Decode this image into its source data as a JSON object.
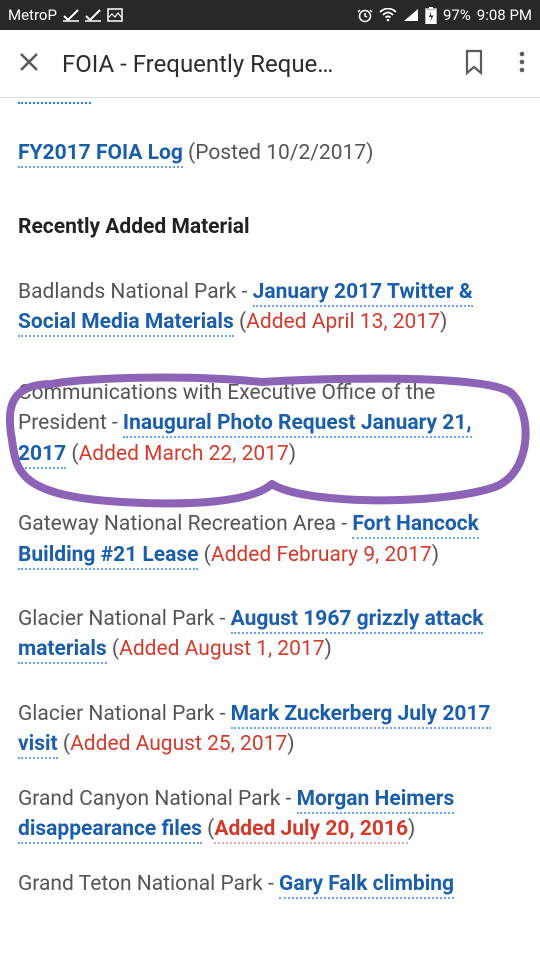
{
  "status": {
    "carrier": "MetroP",
    "battery": "97%",
    "time": "9:08 PM"
  },
  "header": {
    "title": "FOIA - Frequently Reque…"
  },
  "top_link": {
    "label": "FY2017 FOIA Log",
    "posted": " (Posted 10/2/2017)"
  },
  "section_title": "Recently Added Material",
  "items": [
    {
      "prefix": "Badlands National Park - ",
      "link": "January 2017 Twitter & Social Media Materials",
      "added": "Added April 13, 2017"
    },
    {
      "prefix": "Communications with Executive Office of the President - ",
      "link": "Inaugural Photo Request January 21, 2017",
      "added": "Added March 22, 2017"
    },
    {
      "prefix": "Gateway National Recreation Area - ",
      "link": "Fort Hancock Building #21 Lease",
      "added": "Added February 9, 2017"
    },
    {
      "prefix": "Glacier National Park - ",
      "link": "August 1967 grizzly attack materials",
      "added": "Added August 1, 2017"
    },
    {
      "prefix": "Glacier National Park - ",
      "link": "Mark Zuckerberg July 2017 visit",
      "added": "Added August 25, 2017"
    },
    {
      "prefix": "Grand Canyon National Park - ",
      "link": "Morgan Heimers disappearance files",
      "added": "Added July 20, 2016"
    },
    {
      "prefix": "Grand Teton National Park - ",
      "link": "Gary Falk climbing",
      "added": ""
    }
  ]
}
